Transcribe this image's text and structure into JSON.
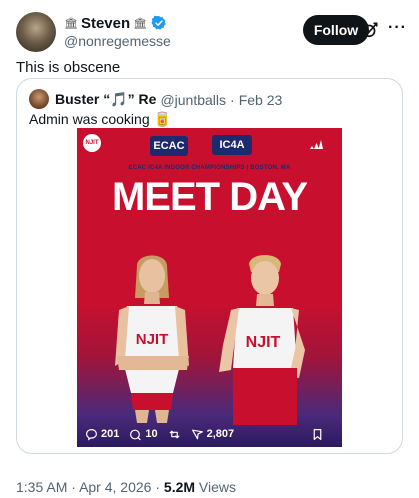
{
  "author": {
    "display_name": "Steven",
    "name_emoji_left": "🏛",
    "name_emoji_right": "🏛",
    "handle": "@nonregemesse"
  },
  "actions": {
    "follow_label": "Follow",
    "more_glyph": "···"
  },
  "tweet": {
    "text": "This is obscene"
  },
  "quote": {
    "display_name": "Buster “🎵” Re",
    "handle": "@juntballs",
    "separator": "·",
    "date": "Feb 23",
    "text": "Admin was cooking 🥫"
  },
  "poster": {
    "badge_njit": "NJIT",
    "badge_ecac": "ECAC",
    "badge_ic4a": "IC4A",
    "subtitle": "ECAC IC4A INDOOR CHAMPIONSHIPS | BOSTON, MA",
    "title": "MEET DAY",
    "jersey_left": "NJIT",
    "jersey_right": "NJIT"
  },
  "engagement": {
    "replies": "201",
    "quotes": "10",
    "likes": "2,807"
  },
  "meta": {
    "time": "1:35 AM",
    "dot": "·",
    "date": "Apr 4, 2026",
    "views_count": "5.2M",
    "views_label": "Views"
  },
  "colors": {
    "poster_red": "#c8102e",
    "navy": "#1d2a6e",
    "verified_blue": "#1d9bf0",
    "follow_bg": "#0f1419",
    "secondary_text": "#536471"
  }
}
